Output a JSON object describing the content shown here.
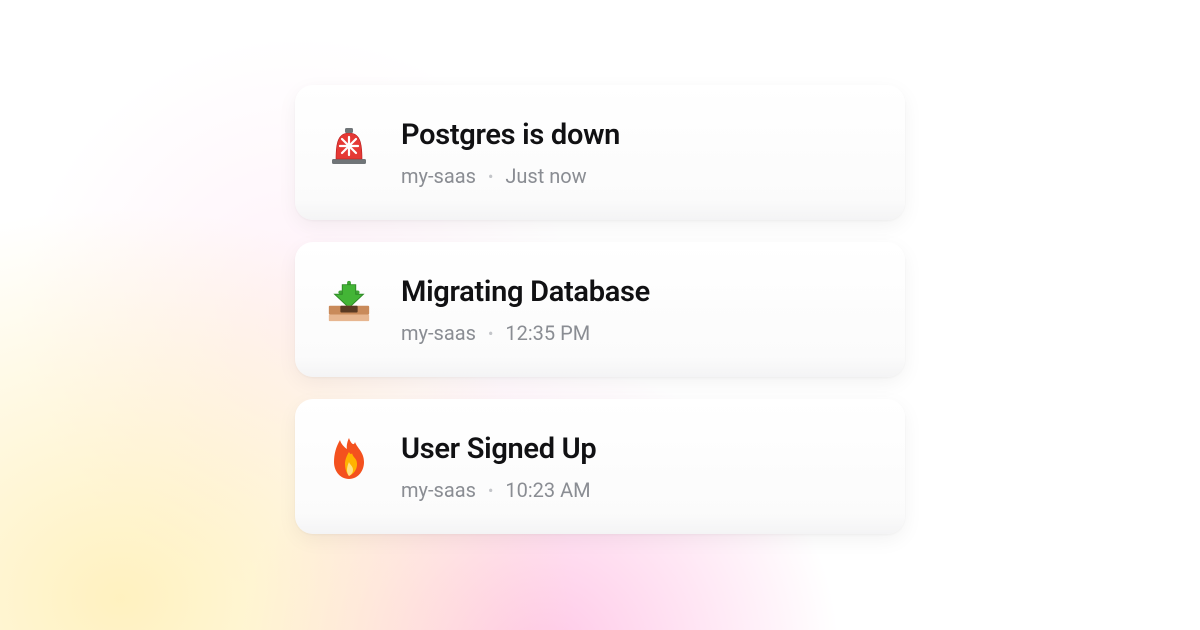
{
  "notifications": [
    {
      "icon": "siren-icon",
      "title": "Postgres is down",
      "project": "my-saas",
      "time": "Just now"
    },
    {
      "icon": "download-tray-icon",
      "title": "Migrating Database",
      "project": "my-saas",
      "time": "12:35 PM"
    },
    {
      "icon": "fire-icon",
      "title": "User Signed Up",
      "project": "my-saas",
      "time": "10:23 AM"
    }
  ]
}
